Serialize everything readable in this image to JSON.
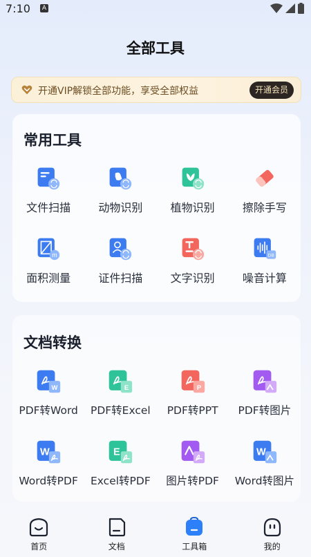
{
  "status_bar": {
    "time": "7:10",
    "badge": "A"
  },
  "page": {
    "title": "全部工具"
  },
  "vip_banner": {
    "text": "开通VIP解锁全部功能，享受全部权益",
    "button": "开通会员"
  },
  "common_tools": {
    "title": "常用工具",
    "items": [
      {
        "label": "文件扫描",
        "icon": "file-scan-icon",
        "color": "#3d7bf0"
      },
      {
        "label": "动物识别",
        "icon": "animal-recognize-icon",
        "color": "#3d7bf0"
      },
      {
        "label": "植物识别",
        "icon": "plant-recognize-icon",
        "color": "#2fc39a"
      },
      {
        "label": "擦除手写",
        "icon": "eraser-icon",
        "color": "#f2665d"
      },
      {
        "label": "面积测量",
        "icon": "area-measure-icon",
        "color": "#3d7bf0"
      },
      {
        "label": "证件扫描",
        "icon": "id-scan-icon",
        "color": "#3d7bf0"
      },
      {
        "label": "文字识别",
        "icon": "text-recognize-icon",
        "color": "#f2665d"
      },
      {
        "label": "噪音计算",
        "icon": "noise-meter-icon",
        "color": "#3d7bf0"
      }
    ]
  },
  "doc_convert": {
    "title": "文档转换",
    "items": [
      {
        "label": "PDF转Word",
        "icon": "pdf-to-word-icon",
        "color": "#3d7bf0",
        "badge": "W"
      },
      {
        "label": "PDF转Excel",
        "icon": "pdf-to-excel-icon",
        "color": "#2fc39a",
        "badge": "E"
      },
      {
        "label": "PDF转PPT",
        "icon": "pdf-to-ppt-icon",
        "color": "#f2665d",
        "badge": "P"
      },
      {
        "label": "PDF转图片",
        "icon": "pdf-to-image-icon",
        "color": "#a35af0",
        "badge": "^"
      },
      {
        "label": "Word转PDF",
        "icon": "word-to-pdf-icon",
        "color": "#3d7bf0",
        "badge": "W"
      },
      {
        "label": "Excel转PDF",
        "icon": "excel-to-pdf-icon",
        "color": "#2fc39a",
        "badge": "E"
      },
      {
        "label": "图片转PDF",
        "icon": "image-to-pdf-icon",
        "color": "#a35af0",
        "badge": "^"
      },
      {
        "label": "Word转图片",
        "icon": "word-to-image-icon",
        "color": "#3d7bf0",
        "badge": "W"
      }
    ]
  },
  "bottom_nav": {
    "items": [
      {
        "label": "首页",
        "icon": "home-icon",
        "active": false
      },
      {
        "label": "文档",
        "icon": "document-icon",
        "active": false
      },
      {
        "label": "工具箱",
        "icon": "toolbox-icon",
        "active": true
      },
      {
        "label": "我的",
        "icon": "profile-icon",
        "active": false
      }
    ]
  },
  "colors": {
    "accent": "#3d7bf0",
    "vip_text": "#6b4c22",
    "vip_button_bg": "#2c2521"
  }
}
